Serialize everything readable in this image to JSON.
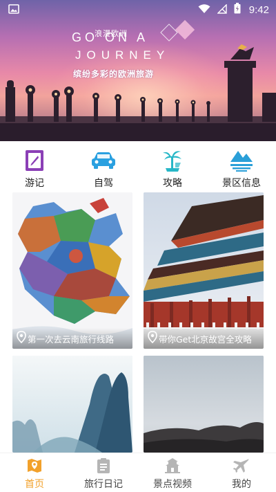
{
  "status_bar": {
    "time": "9:42",
    "icons": [
      "image-icon",
      "wifi-icon",
      "no-signal-icon",
      "battery-charging-icon"
    ]
  },
  "banner": {
    "subtitle_cn": "浪漫欧洲",
    "title_line1": "GO ON A",
    "title_line2": "JOURNEY",
    "slogan": "缤纷多彩的欧洲旅游"
  },
  "quick_categories": [
    {
      "label": "游记",
      "icon": "notebook-icon",
      "color": "#8b3fb6"
    },
    {
      "label": "自驾",
      "icon": "car-icon",
      "color": "#2aa0e0"
    },
    {
      "label": "攻略",
      "icon": "palm-tree-icon",
      "color": "#27b7c7"
    },
    {
      "label": "景区信息",
      "icon": "mountain-lake-icon",
      "color": "#2a9fd8"
    }
  ],
  "cards": [
    {
      "caption": "第一次去云南旅行线路",
      "icon": "location-pin-icon"
    },
    {
      "caption": "带你Get北京故宫全攻略",
      "icon": "location-pin-icon"
    },
    {
      "caption": "",
      "icon": ""
    },
    {
      "caption": "",
      "icon": ""
    }
  ],
  "bottom_nav": [
    {
      "label": "首页",
      "icon": "map-icon",
      "active": true
    },
    {
      "label": "旅行日记",
      "icon": "diary-icon",
      "active": false
    },
    {
      "label": "景点视频",
      "icon": "temple-icon",
      "active": false
    },
    {
      "label": "我的",
      "icon": "airplane-icon",
      "active": false
    }
  ],
  "colors": {
    "accent": "#f2a12b",
    "inactive_nav": "#b5b5b5"
  }
}
